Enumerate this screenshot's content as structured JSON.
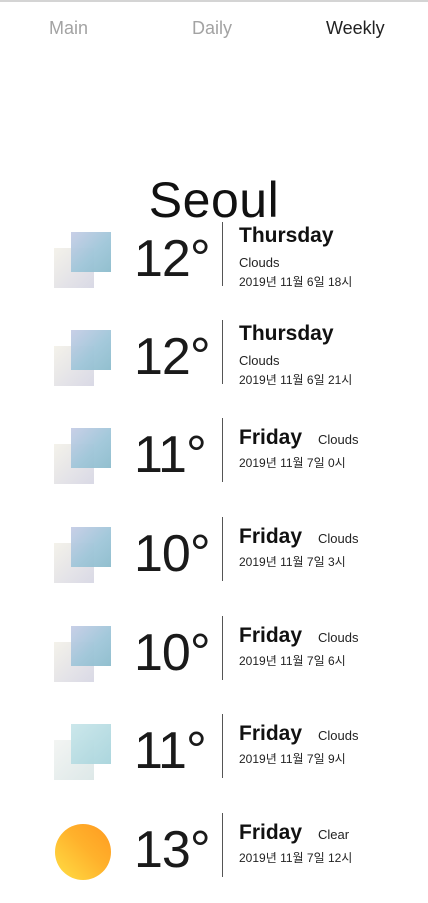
{
  "tabs": [
    {
      "label": "Main",
      "active": false
    },
    {
      "label": "Daily",
      "active": false
    },
    {
      "label": "Weekly",
      "active": true
    }
  ],
  "city": "Seoul",
  "forecast": [
    {
      "temp": "12°",
      "day": "Thursday",
      "desc": "Clouds",
      "datetime": "2019년 11월 6일 18시",
      "icon": "clouds-icon"
    },
    {
      "temp": "12°",
      "day": "Thursday",
      "desc": "Clouds",
      "datetime": "2019년 11월 6일 21시",
      "icon": "clouds-icon"
    },
    {
      "temp": "11°",
      "day": "Friday",
      "desc": "Clouds",
      "datetime": "2019년 11월 7일 0시",
      "icon": "clouds-icon"
    },
    {
      "temp": "10°",
      "day": "Friday",
      "desc": "Clouds",
      "datetime": "2019년 11월 7일 3시",
      "icon": "clouds-icon"
    },
    {
      "temp": "10°",
      "day": "Friday",
      "desc": "Clouds",
      "datetime": "2019년 11월 7일 6시",
      "icon": "clouds-icon"
    },
    {
      "temp": "11°",
      "day": "Friday",
      "desc": "Clouds",
      "datetime": "2019년 11월 7일 9시",
      "icon": "clouds-icon"
    },
    {
      "temp": "13°",
      "day": "Friday",
      "desc": "Clear",
      "datetime": "2019년 11월 7일 12시",
      "icon": "sun-icon"
    }
  ],
  "colors": {
    "active_tab": "#222222",
    "inactive_tab": "#a3a3a3",
    "sun": "#ffb22c",
    "clouds": "#9fc6d9"
  }
}
